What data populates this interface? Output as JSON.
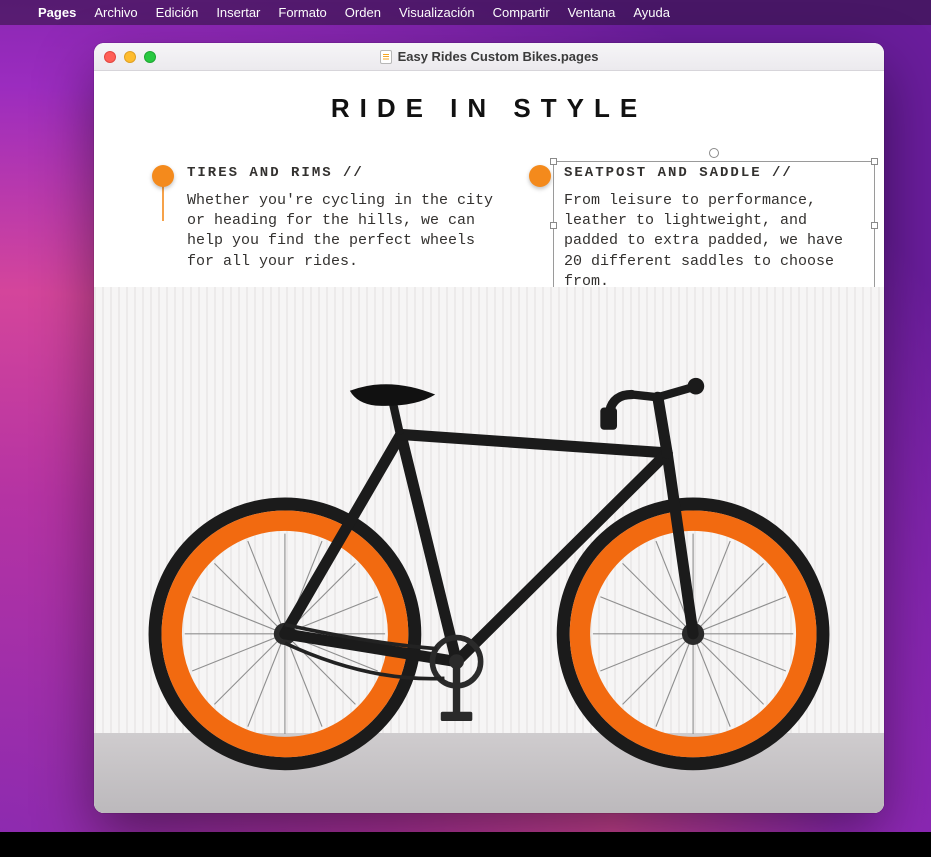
{
  "menubar": {
    "app": "Pages",
    "items": [
      "Archivo",
      "Edición",
      "Insertar",
      "Formato",
      "Orden",
      "Visualización",
      "Compartir",
      "Ventana",
      "Ayuda"
    ]
  },
  "window": {
    "title": "Easy Rides Custom Bikes.pages"
  },
  "document": {
    "headline": "RIDE IN STYLE",
    "callouts": {
      "left": {
        "title": "TIRES AND RIMS //",
        "body": "Whether you're cycling in the city or heading for the hills, we can help you find the perfect wheels for all your rides."
      },
      "right": {
        "title": "SEATPOST AND SADDLE //",
        "body": "From leisure to performance, leather to lightweight, and padded to extra padded, we have 20 different saddles to choose from."
      }
    }
  },
  "colors": {
    "accent": "#f48a1c",
    "rim": "#f26a10"
  }
}
